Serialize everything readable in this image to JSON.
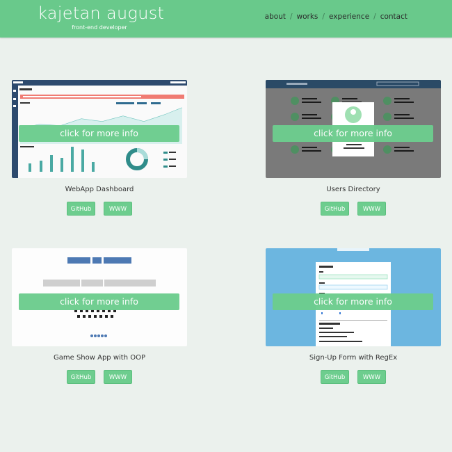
{
  "header": {
    "name": "kajetan august",
    "subtitle": "front-end developer",
    "nav": [
      "about",
      "works",
      "experience",
      "contact"
    ],
    "separator": "/"
  },
  "colors": {
    "accent": "#69c98b",
    "background": "#ebf1ed"
  },
  "projects": [
    {
      "title": "WebApp Dashboard",
      "overlay": "click for more info",
      "github": "GitHub",
      "www": "WWW"
    },
    {
      "title": "Users Directory",
      "overlay": "click for more info",
      "github": "GitHub",
      "www": "WWW"
    },
    {
      "title": "Game Show App with OOP",
      "overlay": "click for more info",
      "github": "GitHub",
      "www": "WWW"
    },
    {
      "title": "Sign-Up Form with RegEx",
      "overlay": "click for more info",
      "github": "GitHub",
      "www": "WWW"
    }
  ]
}
